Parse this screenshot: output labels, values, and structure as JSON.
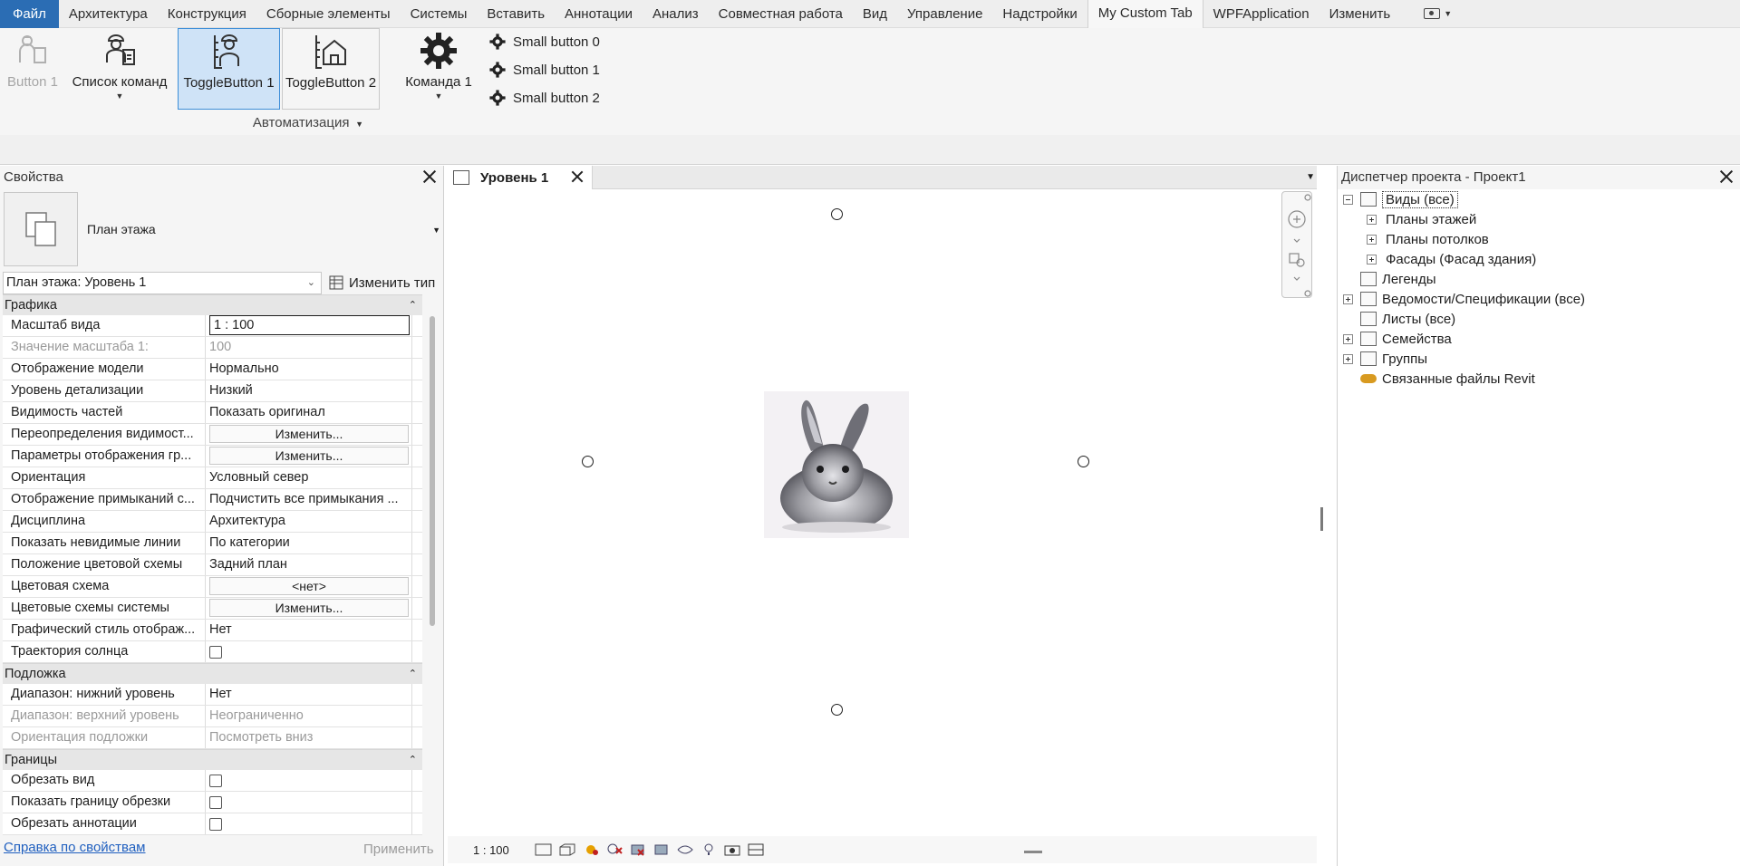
{
  "ribbon_tabs": [
    "Файл",
    "Архитектура",
    "Конструкция",
    "Сборные элементы",
    "Системы",
    "Вставить",
    "Аннотации",
    "Анализ",
    "Совместная работа",
    "Вид",
    "Управление",
    "Надстройки",
    "My Custom Tab",
    "WPFApplication",
    "Изменить"
  ],
  "ribbon": {
    "buttons": [
      "Button 1",
      "Список команд",
      "ToggleButton 1",
      "ToggleButton 2",
      "Команда 1"
    ],
    "small_buttons": [
      "Small button 0",
      "Small button 1",
      "Small button 2"
    ],
    "panel_title": "Автоматизация"
  },
  "properties": {
    "title": "Свойства",
    "type_name": "План этажа",
    "selector": "План этажа: Уровень 1",
    "edit_type": "Изменить тип",
    "sections": {
      "graphics": "Графика",
      "underlay": "Подложка",
      "extents": "Границы"
    },
    "rows": [
      {
        "k": "Масштаб вида",
        "v": "1 : 100"
      },
      {
        "k": "Значение масштаба    1:",
        "v": "100"
      },
      {
        "k": "Отображение модели",
        "v": "Нормально"
      },
      {
        "k": "Уровень детализации",
        "v": "Низкий"
      },
      {
        "k": "Видимость частей",
        "v": "Показать оригинал"
      },
      {
        "k": "Переопределения видимост...",
        "v": "Изменить..."
      },
      {
        "k": "Параметры отображения гр...",
        "v": "Изменить..."
      },
      {
        "k": "Ориентация",
        "v": "Условный север"
      },
      {
        "k": "Отображение примыканий с...",
        "v": "Подчистить все примыкания ..."
      },
      {
        "k": "Дисциплина",
        "v": "Архитектура"
      },
      {
        "k": "Показать невидимые линии",
        "v": "По категории"
      },
      {
        "k": "Положение цветовой схемы",
        "v": "Задний план"
      },
      {
        "k": "Цветовая схема",
        "v": "<нет>"
      },
      {
        "k": "Цветовые схемы системы",
        "v": "Изменить..."
      },
      {
        "k": "Графический стиль отображ...",
        "v": "Нет"
      },
      {
        "k": "Траектория солнца",
        "v": ""
      },
      {
        "k": "Диапазон: нижний уровень",
        "v": "Нет"
      },
      {
        "k": "Диапазон: верхний уровень",
        "v": "Неограниченно"
      },
      {
        "k": "Ориентация подложки",
        "v": "Посмотреть вниз"
      },
      {
        "k": "Обрезать вид",
        "v": ""
      },
      {
        "k": "Показать границу обрезки",
        "v": ""
      },
      {
        "k": "Обрезать аннотации",
        "v": ""
      }
    ],
    "help": "Справка по свойствам",
    "apply": "Применить"
  },
  "view": {
    "tab": "Уровень 1",
    "scale": "1 : 100"
  },
  "browser": {
    "title": "Диспетчер проекта - Проект1",
    "nodes": [
      "Виды (все)",
      "Планы этажей",
      "Планы потолков",
      "Фасады (Фасад здания)",
      "Легенды",
      "Ведомости/Спецификации (все)",
      "Листы (все)",
      "Семейства",
      "Группы",
      "Связанные файлы Revit"
    ]
  }
}
